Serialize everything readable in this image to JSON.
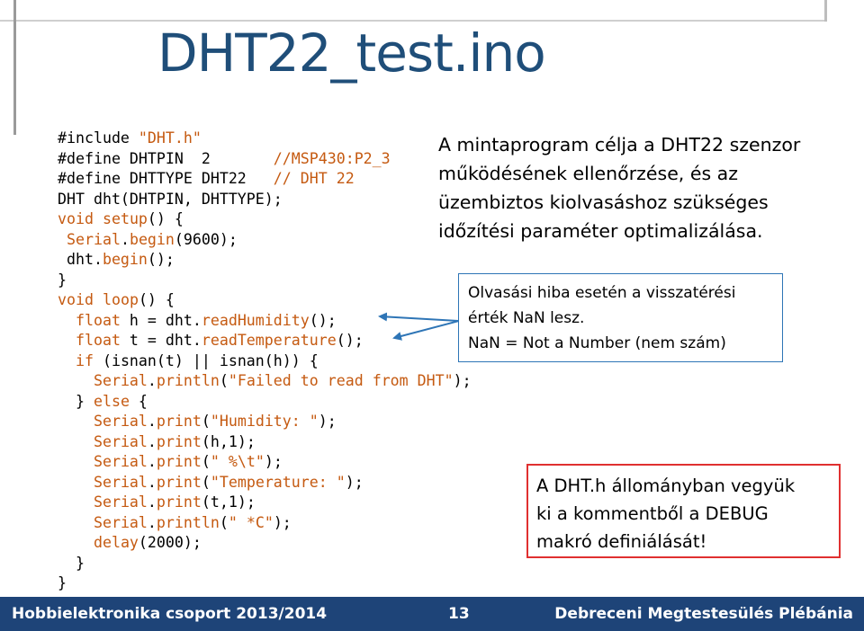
{
  "slide": {
    "title": "DHT22_test.ino",
    "code_lines": [
      [
        {
          "t": "#include ",
          "c": ""
        },
        {
          "t": "\"DHT.h\"",
          "c": "orange"
        }
      ],
      [
        {
          "t": "#define DHTPIN  2       ",
          "c": ""
        },
        {
          "t": "//MSP430:P2_3",
          "c": "orange"
        }
      ],
      [
        {
          "t": "#define DHTTYPE DHT22   ",
          "c": ""
        },
        {
          "t": "// DHT 22",
          "c": "orange"
        }
      ],
      [
        {
          "t": "DHT dht(DHTPIN, DHTTYPE);",
          "c": ""
        }
      ],
      [
        {
          "t": "void",
          "c": "orange"
        },
        {
          "t": " ",
          "c": ""
        },
        {
          "t": "setup",
          "c": "orange"
        },
        {
          "t": "() {",
          "c": ""
        }
      ],
      [
        {
          "t": " ",
          "c": ""
        },
        {
          "t": "Serial",
          "c": "orange"
        },
        {
          "t": ".",
          "c": ""
        },
        {
          "t": "begin",
          "c": "orange"
        },
        {
          "t": "(9600);",
          "c": ""
        }
      ],
      [
        {
          "t": " dht.",
          "c": ""
        },
        {
          "t": "begin",
          "c": "orange"
        },
        {
          "t": "();",
          "c": ""
        }
      ],
      [
        {
          "t": "}",
          "c": ""
        }
      ],
      [
        {
          "t": "void",
          "c": "orange"
        },
        {
          "t": " ",
          "c": ""
        },
        {
          "t": "loop",
          "c": "orange"
        },
        {
          "t": "() {",
          "c": ""
        }
      ],
      [
        {
          "t": "  ",
          "c": ""
        },
        {
          "t": "float",
          "c": "orange"
        },
        {
          "t": " h = dht.",
          "c": ""
        },
        {
          "t": "readHumidity",
          "c": "orange"
        },
        {
          "t": "();",
          "c": ""
        }
      ],
      [
        {
          "t": "  ",
          "c": ""
        },
        {
          "t": "float",
          "c": "orange"
        },
        {
          "t": " t = dht.",
          "c": ""
        },
        {
          "t": "readTemperature",
          "c": "orange"
        },
        {
          "t": "();",
          "c": ""
        }
      ],
      [
        {
          "t": "  ",
          "c": ""
        },
        {
          "t": "if",
          "c": "orange"
        },
        {
          "t": " (isnan(t) || isnan(h)) {",
          "c": ""
        }
      ],
      [
        {
          "t": "    ",
          "c": ""
        },
        {
          "t": "Serial",
          "c": "orange"
        },
        {
          "t": ".",
          "c": ""
        },
        {
          "t": "println",
          "c": "orange"
        },
        {
          "t": "(",
          "c": ""
        },
        {
          "t": "\"Failed to read from DHT\"",
          "c": "orange"
        },
        {
          "t": ");",
          "c": ""
        }
      ],
      [
        {
          "t": "  } ",
          "c": ""
        },
        {
          "t": "else",
          "c": "orange"
        },
        {
          "t": " {",
          "c": ""
        }
      ],
      [
        {
          "t": "    ",
          "c": ""
        },
        {
          "t": "Serial",
          "c": "orange"
        },
        {
          "t": ".",
          "c": ""
        },
        {
          "t": "print",
          "c": "orange"
        },
        {
          "t": "(",
          "c": ""
        },
        {
          "t": "\"Humidity: \"",
          "c": "orange"
        },
        {
          "t": ");",
          "c": ""
        }
      ],
      [
        {
          "t": "    ",
          "c": ""
        },
        {
          "t": "Serial",
          "c": "orange"
        },
        {
          "t": ".",
          "c": ""
        },
        {
          "t": "print",
          "c": "orange"
        },
        {
          "t": "(h,1);",
          "c": ""
        }
      ],
      [
        {
          "t": "    ",
          "c": ""
        },
        {
          "t": "Serial",
          "c": "orange"
        },
        {
          "t": ".",
          "c": ""
        },
        {
          "t": "print",
          "c": "orange"
        },
        {
          "t": "(",
          "c": ""
        },
        {
          "t": "\" %\\t\"",
          "c": "orange"
        },
        {
          "t": ");",
          "c": ""
        }
      ],
      [
        {
          "t": "    ",
          "c": ""
        },
        {
          "t": "Serial",
          "c": "orange"
        },
        {
          "t": ".",
          "c": ""
        },
        {
          "t": "print",
          "c": "orange"
        },
        {
          "t": "(",
          "c": ""
        },
        {
          "t": "\"Temperature: \"",
          "c": "orange"
        },
        {
          "t": ");",
          "c": ""
        }
      ],
      [
        {
          "t": "    ",
          "c": ""
        },
        {
          "t": "Serial",
          "c": "orange"
        },
        {
          "t": ".",
          "c": ""
        },
        {
          "t": "print",
          "c": "orange"
        },
        {
          "t": "(t,1);",
          "c": ""
        }
      ],
      [
        {
          "t": "    ",
          "c": ""
        },
        {
          "t": "Serial",
          "c": "orange"
        },
        {
          "t": ".",
          "c": ""
        },
        {
          "t": "println",
          "c": "orange"
        },
        {
          "t": "(",
          "c": ""
        },
        {
          "t": "\" *C\"",
          "c": "orange"
        },
        {
          "t": ");",
          "c": ""
        }
      ],
      [
        {
          "t": "    ",
          "c": ""
        },
        {
          "t": "delay",
          "c": "orange"
        },
        {
          "t": "(2000);",
          "c": ""
        }
      ],
      [
        {
          "t": "  }",
          "c": ""
        }
      ],
      [
        {
          "t": "}",
          "c": ""
        }
      ]
    ],
    "description_lines": [
      "A mintaprogram célja a DHT22 szenzor",
      "működésének ellenőrzése, és az",
      "üzembiztos kiolvasáshoz szükséges",
      "időzítési paraméter optimalizálása."
    ],
    "callout_lines": [
      "Olvasási hiba esetén a visszatérési",
      "érték NaN lesz.",
      "NaN = Not a Number (nem szám)"
    ],
    "note_lines": [
      "A DHT.h állományban vegyük",
      "ki a kommentből a DEBUG",
      "makró definiálását!"
    ]
  },
  "footer": {
    "left": "Hobbielektronika csoport 2013/2014",
    "page": "13",
    "right": "Debreceni Megtestesülés Plébánia"
  },
  "colors": {
    "title": "#1f4e79",
    "code_keyword": "#c55a11",
    "callout_border": "#2e75b6",
    "note_border": "#e03030",
    "footer_bg": "#1e4478"
  }
}
